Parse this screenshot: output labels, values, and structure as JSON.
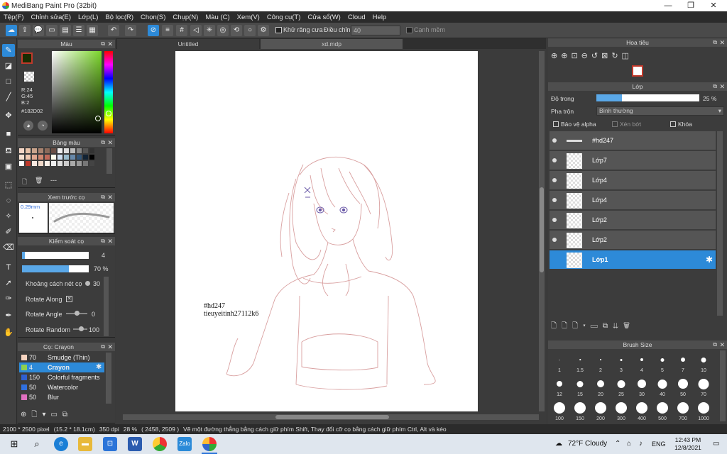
{
  "window": {
    "title": "MediBang Paint Pro (32bit)",
    "minimize": "—",
    "maximize": "❐",
    "close": "✕"
  },
  "menu": [
    "Tệp(F)",
    "Chỉnh sửa(E)",
    "Lớp(L)",
    "Bộ lọc(R)",
    "Chọn(S)",
    "Chụp(N)",
    "Màu (C)",
    "Xem(V)",
    "Công cụ(T)",
    "Cửa sổ(W)",
    "Cloud",
    "Help"
  ],
  "toolbar": {
    "anti_alias_label": "Khử răng cưa",
    "correction_label": "Điều chỉnh",
    "correction_value": "40",
    "snap_label": "Cạnh mềm"
  },
  "color_panel": {
    "title": "Màu",
    "rgb_r": "R:24",
    "rgb_g": "G:45",
    "rgb_b": "B:2",
    "hex": "#182D02",
    "primary_color": "#c0392b",
    "secondary_color": "#000000"
  },
  "palette_panel": {
    "title": "Bảng màu",
    "name": "---"
  },
  "preview_panel": {
    "title": "Xem trước cọ",
    "size": "0.29mm"
  },
  "brush_control": {
    "title": "Kiểm soát cọ",
    "size_value": "4",
    "opacity_value": "70 %",
    "opacity_fraction": 0.7,
    "spacing_label": "Khoảng cách nét cọ",
    "spacing_value": "30",
    "rotate_along_label": "Rotate Along",
    "rotate_angle_label": "Rotate Angle",
    "rotate_angle_value": "0",
    "rotate_random_label": "Rotate Random",
    "rotate_random_value": "100"
  },
  "brush_list": {
    "title": "Cọ: Crayon",
    "items": [
      {
        "num": "70",
        "name": "Smudge (Thin)",
        "color": "#f6d4c0"
      },
      {
        "num": "4",
        "name": "Crayon",
        "color": "#8fd14f"
      },
      {
        "num": "150",
        "name": "Colorful fragments",
        "color": "#3060d0"
      },
      {
        "num": "50",
        "name": "Watercolor",
        "color": "#3070e0"
      },
      {
        "num": "50",
        "name": "Blur",
        "color": "#e070c0"
      }
    ]
  },
  "tabs": [
    "Untitled",
    "xd.mdp"
  ],
  "canvas": {
    "text1": "#hd247",
    "text2": "tieuyeitinh27112k6"
  },
  "navigator": {
    "title": "Hoa tiêu"
  },
  "layer_panel": {
    "title": "Lớp",
    "opacity_label": "Độ trong",
    "opacity_value": "25 %",
    "opacity_fraction": 0.25,
    "blend_label": "Pha trộn",
    "blend_value": "Bình thường",
    "protect_alpha": "Bảo vệ alpha",
    "clipping": "Xén bớt",
    "lock": "Khóa",
    "layers": [
      "#hd247",
      "Lớp7",
      "Lớp4",
      "Lớp4",
      "Lớp2",
      "Lớp2",
      "Lớp1"
    ]
  },
  "brush_size": {
    "title": "Brush Size",
    "sizes": [
      "1",
      "1.5",
      "2",
      "3",
      "4",
      "5",
      "7",
      "10",
      "12",
      "15",
      "20",
      "25",
      "30",
      "40",
      "50",
      "70",
      "100",
      "150",
      "200",
      "300",
      "400",
      "500",
      "700",
      "1000"
    ]
  },
  "status": {
    "dims": "2100 * 2500 pixel",
    "cm": "(15.2 * 18.1cm)",
    "dpi": "350 dpi",
    "zoom": "28 %",
    "coords": "( 2458, 2509 )",
    "hint": "Vẽ một đường thẳng bằng cách giữ phím Shift, Thay đổi cỡ cọ bằng cách giữ phím Ctrl, Alt và kéo"
  },
  "taskbar": {
    "weather": "72°F Cloudy",
    "lang": "ENG",
    "time": "12:43 PM",
    "date": "12/8/2021"
  }
}
